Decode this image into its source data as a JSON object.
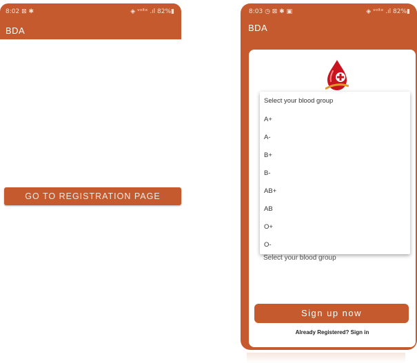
{
  "screen1": {
    "status": {
      "time": "8:02 ⊠ ✱",
      "icons": "◈ ᵛᵒˡᵗᵉ .ıl 82%▮"
    },
    "app_title": "BDA",
    "register_button": "GO TO REGISTRATION PAGE"
  },
  "screen2": {
    "status": {
      "time": "8:03 ◷ ⊠ ✱ ▣",
      "icons": "◈ ᵛᵒˡᵗᵉ .ıl 82%▮"
    },
    "app_title": "BDA",
    "blood_group_field": "Select your blood group",
    "dropdown": {
      "header": "Select your blood group",
      "options": [
        "A+",
        "A-",
        "B+",
        "B-",
        "AB+",
        "AB",
        "O+",
        "O-"
      ]
    },
    "signup_button": "Sign up now",
    "signin_link": "Already Registered? Sign in"
  },
  "colors": {
    "brand": "#c45a2e",
    "background": "#ffffff"
  }
}
